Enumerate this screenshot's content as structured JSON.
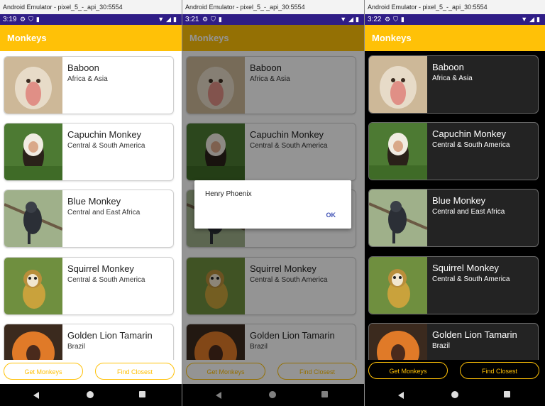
{
  "window": {
    "title": "Android Emulator - pixel_5_-_api_30:5554"
  },
  "panels": [
    {
      "time": "3:19"
    },
    {
      "time": "3:21"
    },
    {
      "time": "3:22"
    }
  ],
  "app": {
    "title": "Monkeys"
  },
  "monkeys": [
    {
      "name": "Baboon",
      "location": "Africa & Asia"
    },
    {
      "name": "Capuchin Monkey",
      "location": "Central & South America"
    },
    {
      "name": "Blue Monkey",
      "location": "Central and East Africa"
    },
    {
      "name": "Squirrel Monkey",
      "location": "Central & South America"
    },
    {
      "name": "Golden Lion Tamarin",
      "location": "Brazil"
    }
  ],
  "buttons": {
    "get_monkeys": "Get Monkeys",
    "find_closest": "Find Closest"
  },
  "dialog": {
    "message": "Henry Phoenix",
    "ok": "OK"
  },
  "icons": {
    "status_left": [
      "gear-icon",
      "shield-icon",
      "sim-icon"
    ],
    "status_right": [
      "wifi-icon",
      "signal-icon",
      "battery-icon"
    ],
    "nav": [
      "back-icon",
      "home-icon",
      "recents-icon"
    ]
  },
  "colors": {
    "accent": "#ffc107",
    "status_bar": "#2f1d86",
    "dialog_button": "#3f51b5"
  }
}
